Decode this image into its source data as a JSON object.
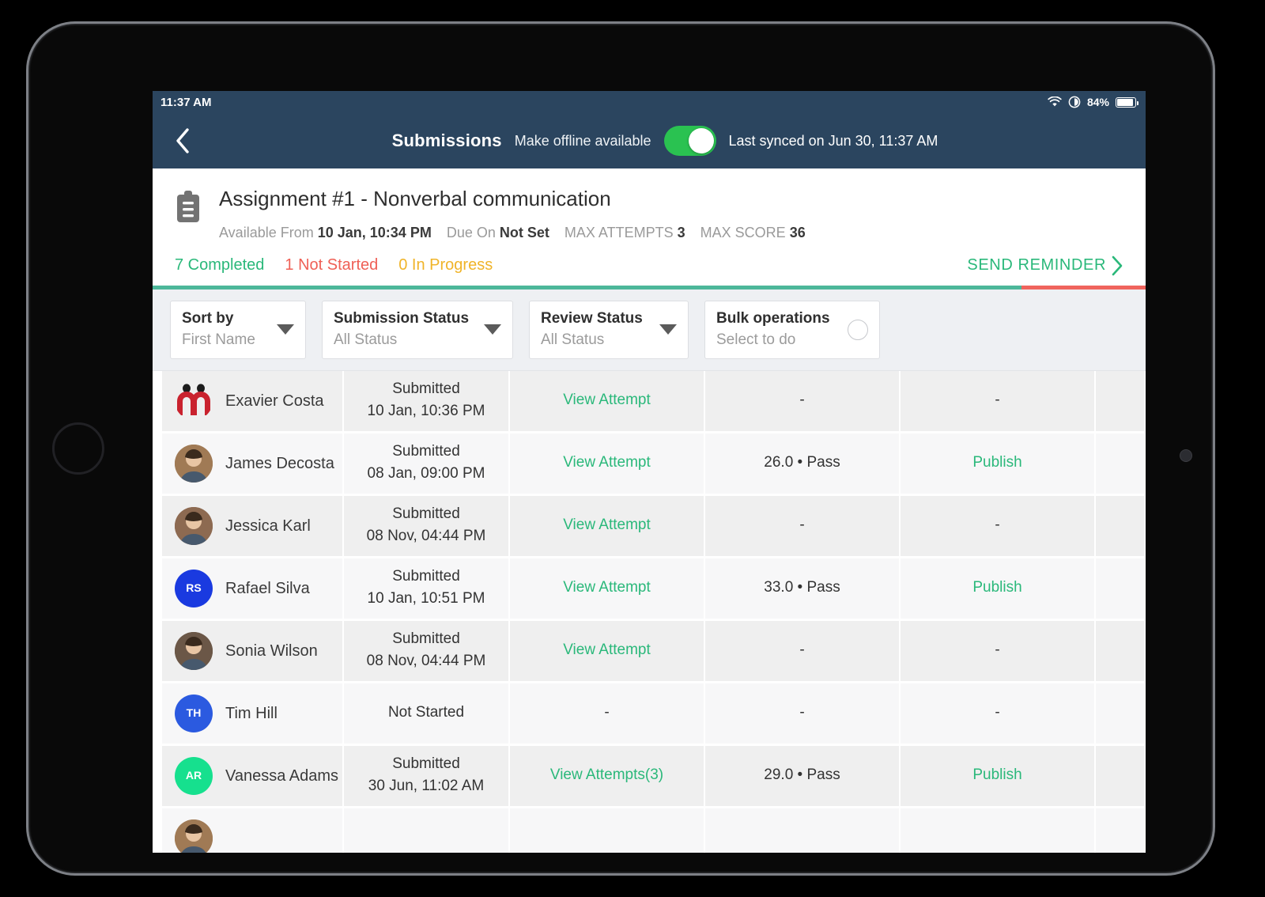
{
  "status_bar": {
    "time": "11:37 AM",
    "battery_pct": "84%",
    "wifi_icon": "wifi-icon",
    "location_icon": "location-icon",
    "battery_icon": "battery-icon"
  },
  "nav": {
    "back_icon": "chevron-left-icon",
    "title": "Submissions",
    "offline_label": "Make offline available",
    "toggle_state": "on",
    "sync_label": "Last synced on Jun 30, 11:37 AM"
  },
  "assignment": {
    "icon": "clipboard-icon",
    "title": "Assignment #1 - Nonverbal communication",
    "meta": [
      {
        "label": "Available From",
        "value": "10 Jan, 10:34 PM"
      },
      {
        "label": "Due On",
        "value": "Not Set"
      },
      {
        "label": "MAX ATTEMPTS",
        "value": "3"
      },
      {
        "label": "MAX SCORE",
        "value": "36"
      }
    ],
    "counts": {
      "completed": "7 Completed",
      "not_started": "1 Not Started",
      "in_progress": "0 In Progress"
    },
    "send_reminder": "SEND REMINDER",
    "send_reminder_icon": "chevron-right-icon",
    "progress_completed_pct": 87.5,
    "colors": {
      "completed": "#2ab87a",
      "not_started": "#ef6056",
      "in_progress": "#f0b429",
      "progress_done": "#4cb79a",
      "progress_rest": "#f0645d",
      "nav_bg": "#2b455f",
      "accent_green": "#2ab87a"
    }
  },
  "filters": [
    {
      "name": "sort-by",
      "title": "Sort by",
      "value": "First Name",
      "control": "chevron-down-icon"
    },
    {
      "name": "submission-status",
      "title": "Submission Status",
      "value": "All Status",
      "control": "chevron-down-icon"
    },
    {
      "name": "review-status",
      "title": "Review Status",
      "value": "All Status",
      "control": "chevron-down-icon"
    },
    {
      "name": "bulk-operations",
      "title": "Bulk operations",
      "value": "Select to do",
      "control": "radio-circle-icon"
    }
  ],
  "table": {
    "rows": [
      {
        "name": "Exavier Costa",
        "avatar": {
          "type": "logo",
          "color": "#c9222e",
          "initials": ""
        },
        "status_line1": "Submitted",
        "status_line2": "10 Jan, 10:36 PM",
        "attempt": "View Attempt",
        "attempt_link": true,
        "score": "-",
        "publish": "-",
        "publish_link": false
      },
      {
        "name": "James Decosta",
        "avatar": {
          "type": "photo",
          "color": "#a07a55",
          "initials": ""
        },
        "status_line1": "Submitted",
        "status_line2": "08 Jan, 09:00 PM",
        "attempt": "View Attempt",
        "attempt_link": true,
        "score": "26.0 • Pass",
        "publish": "Publish",
        "publish_link": true
      },
      {
        "name": "Jessica Karl",
        "avatar": {
          "type": "photo",
          "color": "#8d6a51",
          "initials": ""
        },
        "status_line1": "Submitted",
        "status_line2": "08 Nov, 04:44 PM",
        "attempt": "View Attempt",
        "attempt_link": true,
        "score": "-",
        "publish": "-",
        "publish_link": false
      },
      {
        "name": "Rafael Silva",
        "avatar": {
          "type": "initials",
          "color": "#1a3ae0",
          "initials": "RS"
        },
        "status_line1": "Submitted",
        "status_line2": "10 Jan, 10:51 PM",
        "attempt": "View Attempt",
        "attempt_link": true,
        "score": "33.0 • Pass",
        "publish": "Publish",
        "publish_link": true
      },
      {
        "name": "Sonia Wilson",
        "avatar": {
          "type": "photo",
          "color": "#6b5747",
          "initials": ""
        },
        "status_line1": "Submitted",
        "status_line2": "08 Nov, 04:44 PM",
        "attempt": "View Attempt",
        "attempt_link": true,
        "score": "-",
        "publish": "-",
        "publish_link": false
      },
      {
        "name": "Tim Hill",
        "avatar": {
          "type": "initials",
          "color": "#2b5ae0",
          "initials": "TH"
        },
        "status_line1": "Not Started",
        "status_line2": "",
        "attempt": "-",
        "attempt_link": false,
        "score": "-",
        "publish": "-",
        "publish_link": false
      },
      {
        "name": "Vanessa Adams",
        "avatar": {
          "type": "initials",
          "color": "#16e08e",
          "initials": "AR"
        },
        "status_line1": "Submitted",
        "status_line2": "30 Jun, 11:02 AM",
        "attempt": "View Attempts(3)",
        "attempt_link": true,
        "score": "29.0 • Pass",
        "publish": "Publish",
        "publish_link": true
      },
      {
        "name": "",
        "avatar": {
          "type": "photo",
          "color": "#a07a55",
          "initials": ""
        },
        "status_line1": "",
        "status_line2": "",
        "attempt": "",
        "attempt_link": false,
        "score": "",
        "publish": "",
        "publish_link": false
      }
    ]
  }
}
